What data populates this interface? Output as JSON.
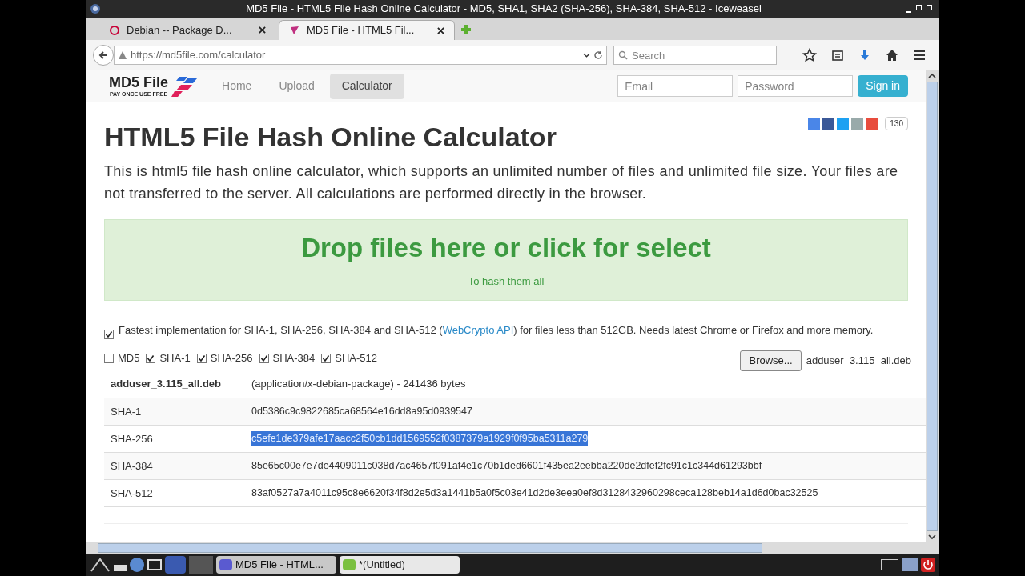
{
  "window": {
    "title": "MD5 File - HTML5 File Hash Online Calculator - MD5, SHA1, SHA2 (SHA-256), SHA-384, SHA-512 - Iceweasel"
  },
  "tabs": [
    {
      "label": "Debian -- Package D...",
      "selected": false
    },
    {
      "label": "MD5 File - HTML5 Fil...",
      "selected": true
    }
  ],
  "address": {
    "url": "https://md5file.com/calculator"
  },
  "search": {
    "placeholder": "Search"
  },
  "site": {
    "logo": "MD5 File",
    "tagline": "PAY ONCE USE FREE",
    "nav": [
      {
        "label": "Home",
        "selected": false
      },
      {
        "label": "Upload",
        "selected": false
      },
      {
        "label": "Calculator",
        "selected": true
      }
    ],
    "email_placeholder": "Email",
    "password_placeholder": "Password",
    "signin": "Sign in",
    "share_count": "130"
  },
  "heading": "HTML5 File Hash Online Calculator",
  "intro": "This is html5 file hash online calculator, which supports an unlimited number of files and unlimited file size. Your files are not transferred to the server. All calculations are performed directly in the browser.",
  "dropzone": {
    "title": "Drop files here or click for select",
    "subtitle": "To hash them all"
  },
  "fastest": {
    "checked": true,
    "before": "Fastest implementation for SHA-1, SHA-256, SHA-384 and SHA-512 (",
    "link": "WebCrypto API",
    "after": ") for files less than 512GB. Needs latest Chrome or Firefox and more memory."
  },
  "algorithms": [
    {
      "label": "MD5",
      "checked": false
    },
    {
      "label": "SHA-1",
      "checked": true
    },
    {
      "label": "SHA-256",
      "checked": true
    },
    {
      "label": "SHA-384",
      "checked": true
    },
    {
      "label": "SHA-512",
      "checked": true
    }
  ],
  "browse": "Browse...",
  "file_name": "adduser_3.115_all.deb",
  "results": {
    "name": "adduser_3.115_all.deb",
    "info": "(application/x-debian-package) - 241436 bytes",
    "rows": [
      {
        "algorithm": "SHA-1",
        "hash": "0d5386c9c9822685ca68564e16dd8a95d0939547",
        "selected": false
      },
      {
        "algorithm": "SHA-256",
        "hash": "c5efe1de379afe17aacc2f50cb1dd1569552f0387379a1929f0f95ba5311a279",
        "selected": true
      },
      {
        "algorithm": "SHA-384",
        "hash": "85e65c00e7e7de4409011c038d7ac4657f091af4e1c70b1ded6601f435ea2eebba220de2dfef2fc91c1c344d61293bbf",
        "selected": false
      },
      {
        "algorithm": "SHA-512",
        "hash": "83af0527a7a4011c95c8e6620f34f8d2e5d3a1441b5a0f5c03e41d2de3eea0ef8d3128432960298ceca128beb14a1d6d0bac32525",
        "selected": false
      }
    ]
  },
  "taskbar": [
    {
      "label": "MD5 File - HTML...",
      "selected": true
    },
    {
      "label": "*(Untitled)",
      "selected": false
    }
  ]
}
